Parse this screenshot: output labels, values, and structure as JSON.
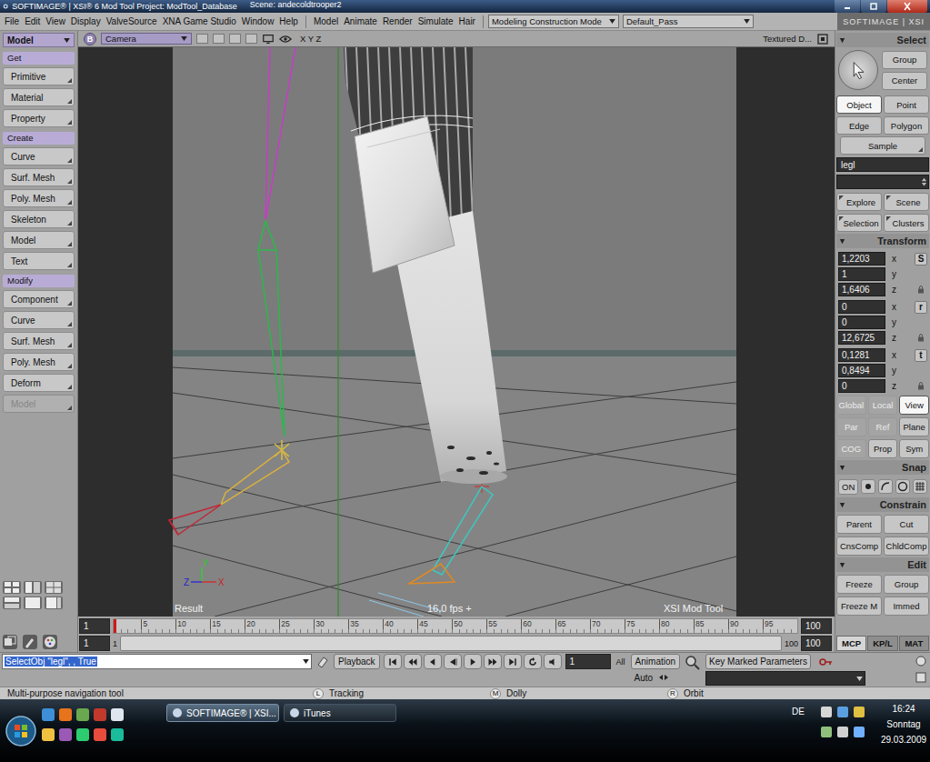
{
  "window": {
    "title": "SOFTIMAGE® | XSI® 6 Mod Tool Project: ModTool_Database",
    "scene": "Scene: andecoldtrooper2",
    "logo": "SOFTIMAGE | XSI"
  },
  "menu": [
    "File",
    "Edit",
    "View",
    "Display",
    "ValveSource",
    "XNA Game Studio",
    "Window",
    "Help"
  ],
  "module_menu": [
    "Model",
    "Animate",
    "Render",
    "Simulate",
    "Hair"
  ],
  "mode_dropdown": "Modeling Construction Mode",
  "pass_dropdown": "Default_Pass",
  "left_panel": {
    "module": "Model",
    "sections": [
      {
        "title": "Get",
        "items": [
          {
            "label": "Primitive",
            "disabled": false
          },
          {
            "label": "Material",
            "disabled": false
          },
          {
            "label": "Property",
            "disabled": false
          }
        ]
      },
      {
        "title": "Create",
        "items": [
          {
            "label": "Curve",
            "disabled": false
          },
          {
            "label": "Surf. Mesh",
            "disabled": false
          },
          {
            "label": "Poly. Mesh",
            "disabled": false
          },
          {
            "label": "Skeleton",
            "disabled": false
          },
          {
            "label": "Model",
            "disabled": false
          },
          {
            "label": "Text",
            "disabled": false
          }
        ]
      },
      {
        "title": "Modify",
        "items": [
          {
            "label": "Component",
            "disabled": false
          },
          {
            "label": "Curve",
            "disabled": false
          },
          {
            "label": "Surf. Mesh",
            "disabled": false
          },
          {
            "label": "Poly. Mesh",
            "disabled": false
          },
          {
            "label": "Deform",
            "disabled": false
          },
          {
            "label": "Model",
            "disabled": true
          }
        ]
      }
    ]
  },
  "viewport": {
    "view_letter": "B",
    "camera": "Camera",
    "axes": "X Y Z",
    "display_mode": "Textured D...",
    "result": "Result",
    "fps": "16,0 fps +",
    "product": "XSI Mod Tool",
    "gizmo": {
      "y": "Y",
      "z": "Z",
      "x": "X"
    }
  },
  "select_panel": {
    "title": "Select",
    "tools": [
      "Group",
      "Center"
    ],
    "filters": [
      {
        "label": "Object",
        "selected": true
      },
      {
        "label": "Point",
        "selected": false
      },
      {
        "label": "Edge",
        "selected": false
      },
      {
        "label": "Polygon",
        "selected": false
      }
    ],
    "sample": "Sample",
    "name_field": "legl",
    "second_field": "",
    "explorers": [
      "Explore",
      "Scene",
      "Selection",
      "Clusters"
    ]
  },
  "transform": {
    "title": "Transform",
    "groups": [
      {
        "letter": "S",
        "values": [
          {
            "axis": "x",
            "value": "1,2203"
          },
          {
            "axis": "y",
            "value": "1"
          },
          {
            "axis": "z",
            "value": "1,6406"
          }
        ]
      },
      {
        "letter": "r",
        "values": [
          {
            "axis": "x",
            "value": "0"
          },
          {
            "axis": "y",
            "value": "0"
          },
          {
            "axis": "z",
            "value": "12,6725"
          }
        ]
      },
      {
        "letter": "t",
        "values": [
          {
            "axis": "x",
            "value": "0,1281"
          },
          {
            "axis": "y",
            "value": "0,8494"
          },
          {
            "axis": "z",
            "value": "0"
          }
        ]
      }
    ],
    "reference_rows": [
      [
        {
          "label": "Global",
          "kind": "radio",
          "selected": false,
          "disabled": false
        },
        {
          "label": "Local",
          "kind": "radio",
          "selected": false,
          "disabled": false
        },
        {
          "label": "View",
          "kind": "radio",
          "selected": true,
          "disabled": false
        }
      ],
      [
        {
          "label": "Par",
          "kind": "toggle",
          "selected": false,
          "disabled": true
        },
        {
          "label": "Ref",
          "kind": "toggle",
          "selected": false,
          "disabled": true
        },
        {
          "label": "Plane",
          "kind": "toggle",
          "selected": false,
          "disabled": false
        }
      ],
      [
        {
          "label": "COG",
          "kind": "toggle",
          "selected": false,
          "disabled": true
        },
        {
          "label": "Prop",
          "kind": "toggle",
          "selected": false,
          "disabled": false
        },
        {
          "label": "Sym",
          "kind": "toggle",
          "selected": false,
          "disabled": false
        }
      ]
    ]
  },
  "snap": {
    "title": "Snap",
    "on": "ON"
  },
  "constrain": {
    "title": "Constrain",
    "buttons": [
      "Parent",
      "Cut",
      "CnsComp",
      "ChldComp"
    ]
  },
  "edit": {
    "title": "Edit",
    "buttons": [
      "Freeze",
      "Group",
      "Freeze M",
      "Immed"
    ]
  },
  "panel_tabs": [
    {
      "label": "MCP",
      "selected": true
    },
    {
      "label": "KP/L",
      "selected": false
    },
    {
      "label": "MAT",
      "selected": false
    }
  ],
  "timeline": {
    "start": "1",
    "end": "100",
    "ticks": [
      "5",
      "10",
      "15",
      "20",
      "25",
      "30",
      "35",
      "40",
      "45",
      "50",
      "55",
      "60",
      "65",
      "70",
      "75",
      "80",
      "85",
      "90",
      "95"
    ],
    "range_start": "1",
    "range_in": "1",
    "range_out": "100",
    "range_end": "100",
    "playhead_level": 0
  },
  "toolbar": {
    "command": "SelectObj \"legl\", , True",
    "playback": "Playback",
    "frame": "1",
    "all": "All",
    "animation": "Animation",
    "auto": "Auto",
    "key_marked": "Key Marked Parameters"
  },
  "status_bar": {
    "message": "Multi-purpose navigation tool",
    "mouse_hints": [
      {
        "key": "L",
        "label": "Tracking"
      },
      {
        "key": "M",
        "label": "Dolly"
      },
      {
        "key": "R",
        "label": "Orbit"
      }
    ]
  },
  "taskbar": {
    "tasks": [
      {
        "label": "SOFTIMAGE® | XSI...",
        "selected": true
      },
      {
        "label": "iTunes",
        "selected": false
      }
    ],
    "language": "DE",
    "time": "16:24",
    "day": "Sonntag",
    "date": "29.03.2009"
  }
}
